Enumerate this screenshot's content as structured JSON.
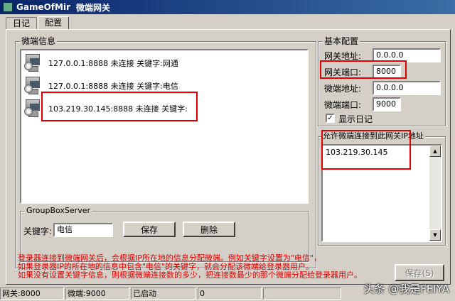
{
  "window": {
    "title": "GameOfMir",
    "subtitle": "微端网关"
  },
  "tabs": [
    {
      "label": "日记"
    },
    {
      "label": "配置"
    }
  ],
  "clients_group": {
    "title": "微端信息",
    "items": [
      {
        "text": "127.0.0.1:8888 未连接 关键字:网通"
      },
      {
        "text": "127.0.0.1:8888 未连接 关键字:电信"
      },
      {
        "text": "103.219.30.145:8888 未连接 关键字:"
      }
    ]
  },
  "server_group": {
    "title": "GroupBoxServer",
    "keyword_label": "关键字:",
    "keyword_value": "电信",
    "save_label": "保存",
    "delete_label": "删除"
  },
  "basic_config": {
    "title": "基本配置",
    "gateway_address_label": "网关地址:",
    "gateway_address_value": "0.0.0.0",
    "gateway_port_label": "网关端口:",
    "gateway_port_value": "8000",
    "client_address_label": "微端地址:",
    "client_address_value": "0.0.0.0",
    "client_port_label": "微端端口:",
    "client_port_value": "9000",
    "show_log_label": "显示日记",
    "show_log_checked": "✓"
  },
  "allowed_ips": {
    "title": "允许微端连接到此网关IP地址",
    "value": "103.219.30.145"
  },
  "notes": [
    "登录器连接到微端网关后，会根据IP所在地的信息分配微端。例如关键字设置为\"电信\"，",
    "如果登录器IP的所在地的信息中包含\"电信\"的关键字，就会分配该微端给登录器用户。",
    "如果没有设置关键字信息，则根据微端连接数的多少，把连接数最少的那个微端分配给登录器用户。"
  ],
  "save_button_label": "保存(S)",
  "status": {
    "gateway": "网关:8000",
    "client": "微端:9000",
    "state": "已启动",
    "count": "0"
  },
  "watermark": "头条 @我是FEIYA",
  "colors": {
    "annotation_red": "#e00000",
    "title_bar": "#0a246a",
    "window_bg": "#d4d0c8"
  }
}
